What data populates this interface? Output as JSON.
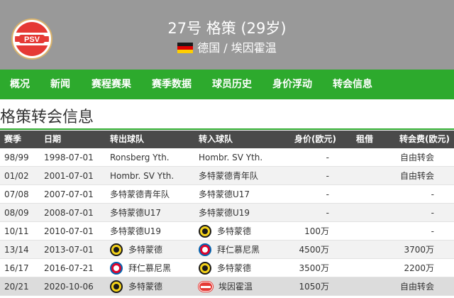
{
  "header": {
    "player_title": "27号 格策 (29岁)",
    "nationality": "德国 / 埃因霍温",
    "logo_text": "PSV",
    "colors": {
      "background": "#999999",
      "accent": "#2daa2d"
    }
  },
  "nav": {
    "items": [
      "概况",
      "新闻",
      "赛程赛果",
      "赛季数据",
      "球员历史",
      "身价浮动",
      "转会信息"
    ]
  },
  "page_title": "格策转会信息",
  "table": {
    "headers": {
      "season": "赛季",
      "date": "日期",
      "from": "转出球队",
      "to": "转入球队",
      "value": "身价(欧元)",
      "loan": "租借",
      "fee": "转会费(欧元)"
    },
    "rows": [
      {
        "season": "98/99",
        "date": "1998-07-01",
        "from": "Ronsberg Yth.",
        "from_icon": "",
        "to": "Hombr. SV Yth.",
        "to_icon": "",
        "value": "-",
        "loan": "",
        "fee": "自由转会"
      },
      {
        "season": "01/02",
        "date": "2001-07-01",
        "from": "Hombr. SV Yth.",
        "from_icon": "",
        "to": "多特蒙德青年队",
        "to_icon": "",
        "value": "-",
        "loan": "",
        "fee": "自由转会"
      },
      {
        "season": "07/08",
        "date": "2007-07-01",
        "from": "多特蒙德青年队",
        "from_icon": "",
        "to": "多特蒙德U17",
        "to_icon": "",
        "value": "-",
        "loan": "",
        "fee": "-"
      },
      {
        "season": "08/09",
        "date": "2008-07-01",
        "from": "多特蒙德U17",
        "from_icon": "",
        "to": "多特蒙德U19",
        "to_icon": "",
        "value": "-",
        "loan": "",
        "fee": "-"
      },
      {
        "season": "10/11",
        "date": "2010-07-01",
        "from": "多特蒙德U19",
        "from_icon": "",
        "to": "多特蒙德",
        "to_icon": "bvb",
        "value": "100万",
        "loan": "",
        "fee": "-"
      },
      {
        "season": "13/14",
        "date": "2013-07-01",
        "from": "多特蒙德",
        "from_icon": "bvb",
        "to": "拜仁慕尼黑",
        "to_icon": "fcb",
        "value": "4500万",
        "loan": "",
        "fee": "3700万"
      },
      {
        "season": "16/17",
        "date": "2016-07-21",
        "from": "拜仁慕尼黑",
        "from_icon": "fcb",
        "to": "多特蒙德",
        "to_icon": "bvb",
        "value": "3500万",
        "loan": "",
        "fee": "2200万"
      },
      {
        "season": "20/21",
        "date": "2020-10-06",
        "from": "多特蒙德",
        "from_icon": "bvb",
        "to": "埃因霍温",
        "to_icon": "psv",
        "value": "1050万",
        "loan": "",
        "fee": "自由转会"
      }
    ]
  }
}
